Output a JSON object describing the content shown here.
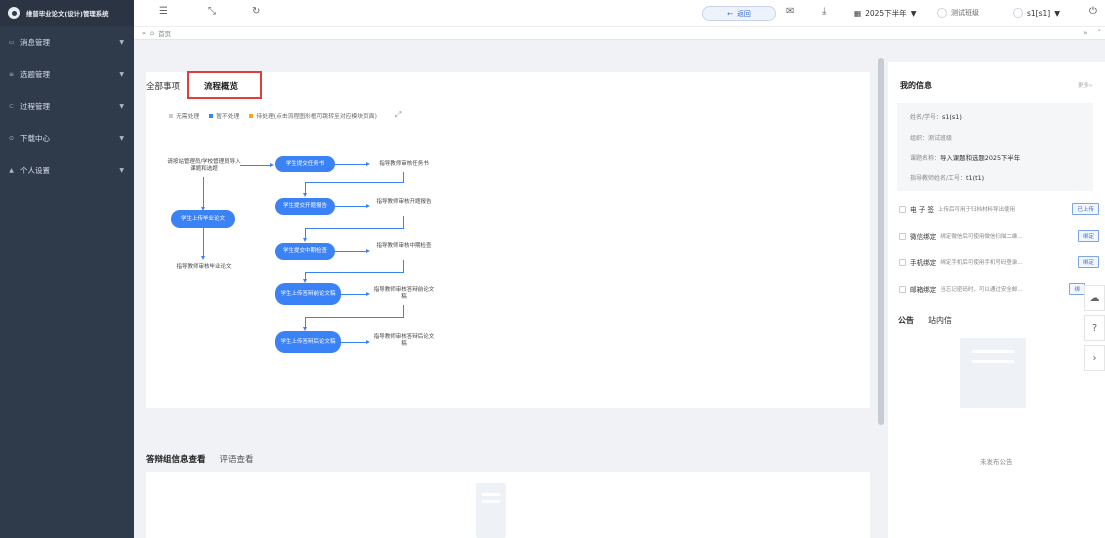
{
  "app": {
    "title": "维普毕业论文(设计)管理系统"
  },
  "sidebar": {
    "items": [
      {
        "label": "消息管理",
        "icon": "message-icon"
      },
      {
        "label": "选题管理",
        "icon": "list-icon"
      },
      {
        "label": "过程管理",
        "icon": "process-icon"
      },
      {
        "label": "下载中心",
        "icon": "download-icon"
      },
      {
        "label": "个人设置",
        "icon": "user-icon"
      }
    ]
  },
  "topbar": {
    "back_label": "返回",
    "semester": "2025下半年",
    "class_label": "测试班级",
    "user_label": "s1[s1]"
  },
  "breadcrumb": {
    "home": "首页",
    "prefix": "«"
  },
  "tabs": {
    "all": "全部事项",
    "overview": "流程概览"
  },
  "legend": {
    "no_action": "无需处理",
    "pending_skip": "暂不处理",
    "pending": "待处理(点击流程图形框可跳转至对应模块页面)",
    "legend_colors": {
      "no_action": "#cccccc",
      "pending_skip": "#3b82f6",
      "pending": "#f5a623"
    }
  },
  "flow": {
    "left_top": "请按站管理员/学校管理员导入课题和选题",
    "left_node": "学生上传毕业论文",
    "left_bottom": "指导教师审核毕业论文",
    "steps": [
      {
        "node": "学生提交任务书",
        "review": "指导教师审核任务书"
      },
      {
        "node": "学生提交开题报告",
        "review": "指导教师审核开题报告"
      },
      {
        "node": "学生提交中期检查",
        "review": "指导教师审核中期检查"
      },
      {
        "node": "学生上传答辩前论文稿",
        "review": "指导教师审核答辩前论文稿"
      },
      {
        "node": "学生上传答辩后论文稿",
        "review": "指导教师审核答辩后论文稿"
      }
    ]
  },
  "lower": {
    "tab1": "答辩组信息查看",
    "tab2": "评语查看"
  },
  "my_info": {
    "title": "我的信息",
    "more": "更多»",
    "name_label": "姓名/学号：",
    "name_value": "s1(s1)",
    "org_label": "组织：",
    "org_value": "测试班级",
    "topic_label": "课题名称：",
    "topic_value": "导入课题和选题2025下半年",
    "teacher_label": "指导教师姓名/工号：",
    "teacher_value": "t1(t1)"
  },
  "bindings": [
    {
      "name": "电 子 签",
      "desc": "上传后可用于归档材料导出使用",
      "btn": "已上传"
    },
    {
      "name": "微信绑定",
      "desc": "绑定微信后可使用微信扫描二维...",
      "btn": "绑定"
    },
    {
      "name": "手机绑定",
      "desc": "绑定手机后可使用手机号码登录...",
      "btn": "绑定"
    },
    {
      "name": "邮箱绑定",
      "desc": "当忘记密码时，可以通过安全邮...",
      "btn": "绑"
    }
  ],
  "notice": {
    "tab1": "公告",
    "tab2": "站内信",
    "empty": "未发布公告"
  }
}
